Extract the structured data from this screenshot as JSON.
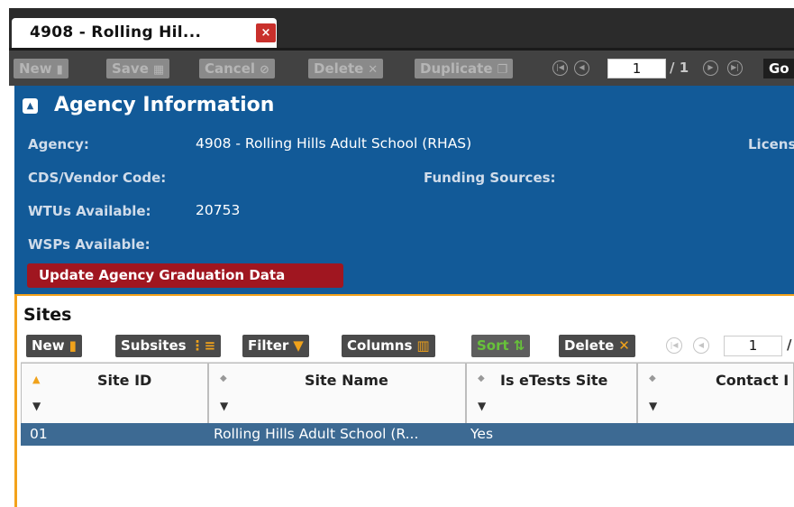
{
  "tab": {
    "title": "4908 - Rolling Hil...",
    "close": "×"
  },
  "toolbar": {
    "buttons": {
      "new": "New",
      "save": "Save",
      "cancel": "Cancel",
      "delete": "Delete",
      "duplicate": "Duplicate"
    },
    "icons": {
      "new": "new-doc-icon",
      "save": "save-icon",
      "cancel": "cancel-icon",
      "delete": "delete-x-icon",
      "duplicate": "duplicate-icon"
    },
    "page": "1",
    "of": "/ 1",
    "go": "Go"
  },
  "agency": {
    "title": "Agency Information",
    "agency_label": "Agency:",
    "agency_value": "4908 - Rolling Hills Adult School (RHAS)",
    "license_label": "Licens",
    "cds_label": "CDS/Vendor Code:",
    "funding_label": "Funding Sources:",
    "wtus_label": "WTUs Available:",
    "wtus_value": "20753",
    "wsps_label": "WSPs Available:",
    "update_button": "Update Agency Graduation Data"
  },
  "sites": {
    "title": "Sites",
    "buttons": {
      "new": "New",
      "subsites": "Subsites",
      "filter": "Filter",
      "columns": "Columns",
      "sort": "Sort",
      "delete": "Delete"
    },
    "page": "1",
    "of": "/",
    "columns": [
      "Site ID",
      "Site Name",
      "Is eTests Site",
      "Contact I"
    ],
    "rows": [
      {
        "site_id": "01",
        "site_name": "Rolling Hills Adult School (R...",
        "is_etests": "Yes"
      }
    ]
  },
  "colors": {
    "agency_bg": "#125a98",
    "accent_orange": "#f3a21b",
    "update_red": "#a01620",
    "row_selected": "#3d6a93"
  }
}
